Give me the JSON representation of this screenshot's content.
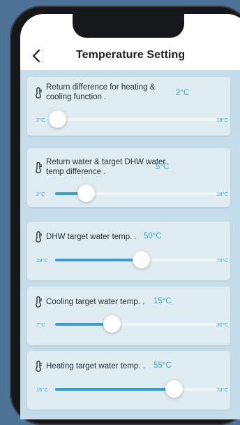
{
  "header": {
    "title": "Temperature Setting",
    "back_icon": "chevron-left-icon"
  },
  "settings": [
    {
      "label": "Return difference for heating & cooling function .",
      "value": "2°C",
      "min": "2°C",
      "max": "18°C",
      "min_num": 2,
      "max_num": 18,
      "current": 2
    },
    {
      "label": "Return water & target DHW water temp difference .",
      "value": "5°C",
      "min": "2°C",
      "max": "18°C",
      "min_num": 2,
      "max_num": 18,
      "current": 5
    },
    {
      "label": "DHW target water temp. .",
      "value": "50°C",
      "min": "28°C",
      "max": "70°C",
      "min_num": 28,
      "max_num": 70,
      "current": 50
    },
    {
      "label": "Cooling target water temp. .",
      "value": "15°C",
      "min": "7°C",
      "max": "30°C",
      "min_num": 7,
      "max_num": 30,
      "current": 15
    },
    {
      "label": "Heating target water temp. .",
      "value": "55°C",
      "min": "15°C",
      "max": "70°C",
      "min_num": 15,
      "max_num": 70,
      "current": 55
    }
  ],
  "colors": {
    "accent": "#3c9fcb",
    "value_text": "#3aa7d0",
    "card_bg": "#dfedf3",
    "page_bg": "#c5dde8"
  },
  "icons": {
    "setting_icon": "thermometer-icon"
  }
}
